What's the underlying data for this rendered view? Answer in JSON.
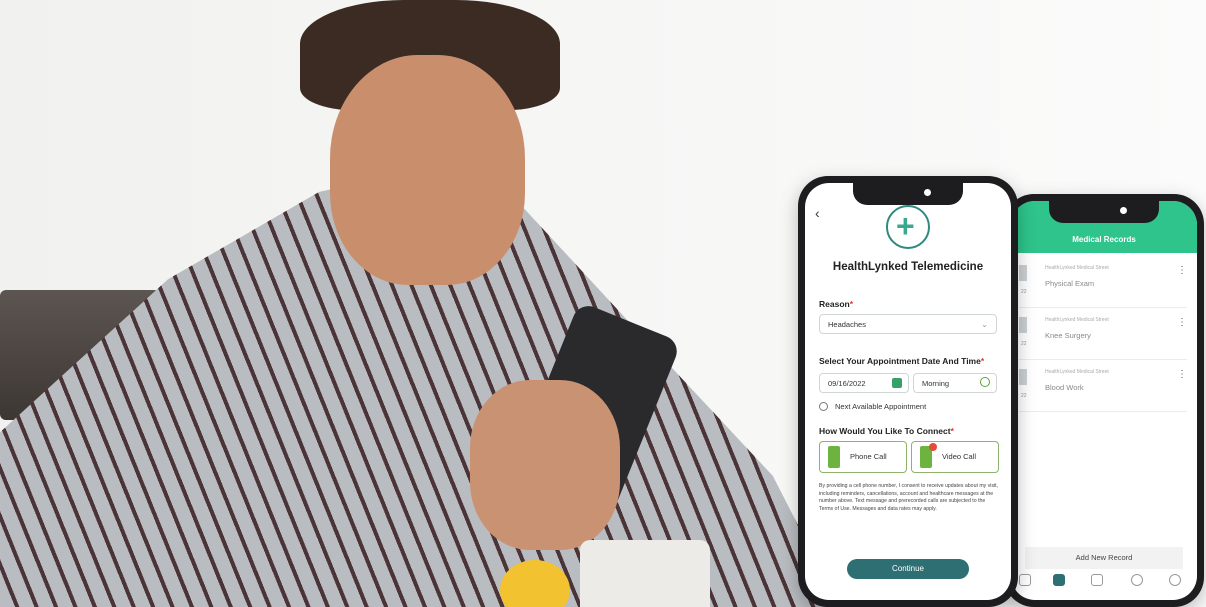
{
  "photo": {
    "description_icon": "person-with-phone-photo"
  },
  "front_phone": {
    "back_icon": "‹",
    "app_title": "HealthLynked Telemedicine",
    "reason_label": "Reason",
    "reason_value": "Headaches",
    "datetime_label": "Select Your Appointment Date And Time",
    "date_value": "09/16/2022",
    "time_value": "Morning",
    "next_available": "Next Available Appointment",
    "connect_label": "How Would You Like To Connect",
    "phone_call": "Phone Call",
    "video_call": "Video Call",
    "disclaimer": "By providing a cell phone number, I consent to receive updates about my visit, including reminders, cancellations, account and healthcare messages at the number above. Text message and prerecorded calls are subjected to the Terms of Use. Messages and data rates may apply.",
    "continue": "Continue",
    "required_mark": "*"
  },
  "back_phone": {
    "header_title": "Medical Records",
    "records": [
      {
        "sub": "HealthLynked Medical Street",
        "name": "Physical Exam",
        "year": "22"
      },
      {
        "sub": "HealthLynked Medical Street",
        "name": "Knee Surgery",
        "year": "22"
      },
      {
        "sub": "HealthLynked Medical Street",
        "name": "Blood Work",
        "year": "22"
      }
    ],
    "add_new": "Add New Record"
  },
  "colors": {
    "brand_green": "#2ec48b",
    "button_teal": "#2e6f73",
    "required_red": "#dd3333"
  }
}
